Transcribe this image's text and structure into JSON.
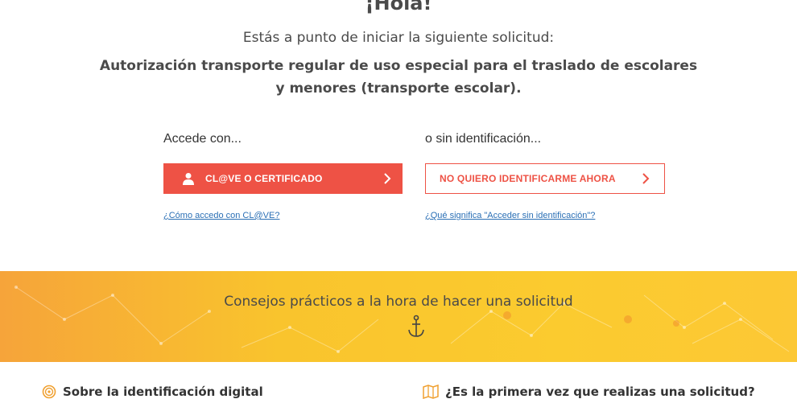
{
  "header": {
    "greeting": "¡Hola!",
    "intro": "Estás a punto de iniciar la siguiente solicitud:",
    "procedure_line1": "Autorización transporte regular de uso especial para el traslado de escolares",
    "procedure_line2": "y menores (transporte escolar)."
  },
  "login": {
    "access_label": "Accede con...",
    "clave_button": "CL@VE O CERTIFICADO",
    "clave_help": "¿Cómo accedo con CL@VE?",
    "anon_label": "o sin identificación...",
    "anon_button": "NO QUIERO IDENTIFICARME AHORA",
    "anon_help": "¿Qué significa \"Acceder sin identificación\"?"
  },
  "tips": {
    "title": "Consejos prácticos a la hora de hacer una solicitud",
    "icon": "anchor-icon"
  },
  "bottom": {
    "left_item": "Sobre la identificación digital",
    "left_icon": "fingerprint-icon",
    "right_item": "¿Es la primera vez que realizas una solicitud?",
    "right_icon": "map-icon"
  },
  "colors": {
    "accent": "#ee5245",
    "link": "#2a6fb5",
    "banner_start": "#f6a43a",
    "banner_end": "#fcc835"
  }
}
